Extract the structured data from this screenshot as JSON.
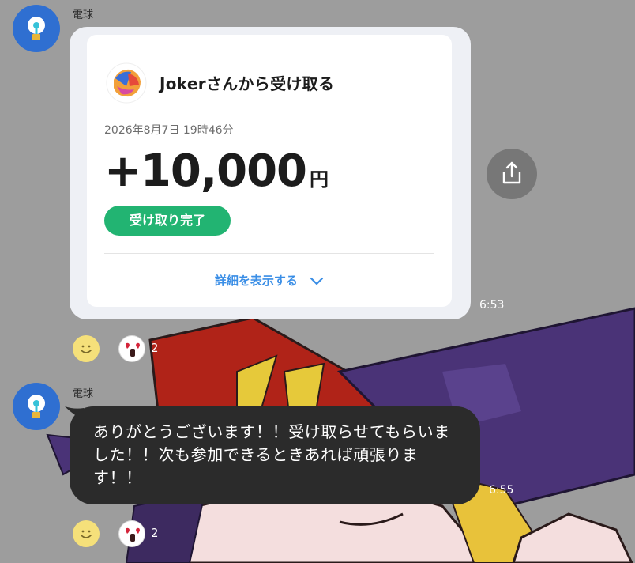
{
  "messages": [
    {
      "sender": "電球",
      "time": "6:53",
      "payment": {
        "title": "Jokerさんから受け取る",
        "datetime": "2026年8月7日 19時46分",
        "amount": "+10,000",
        "currency": "円",
        "status": "受け取り完了",
        "details_link": "詳細を表示する"
      },
      "reactions": {
        "count": "2"
      }
    },
    {
      "sender": "電球",
      "time": "6:55",
      "text": "ありがとうございます！！受け取らせてもらいました！！次も参加できるときあれば頑張ります！！",
      "reactions": {
        "count": "2"
      }
    }
  ],
  "icons": {
    "avatar": "lightbulb-icon",
    "share": "share-icon",
    "add_reaction": "smiley-icon",
    "reaction": "heart-eyes-sticker-icon",
    "details_toggle": "chevron-down-icon"
  },
  "colors": {
    "status_green": "#22b472",
    "link_blue": "#3a8ee6",
    "avatar_blue": "#2f6fd1",
    "bubble_dark": "#2b2b2b"
  }
}
